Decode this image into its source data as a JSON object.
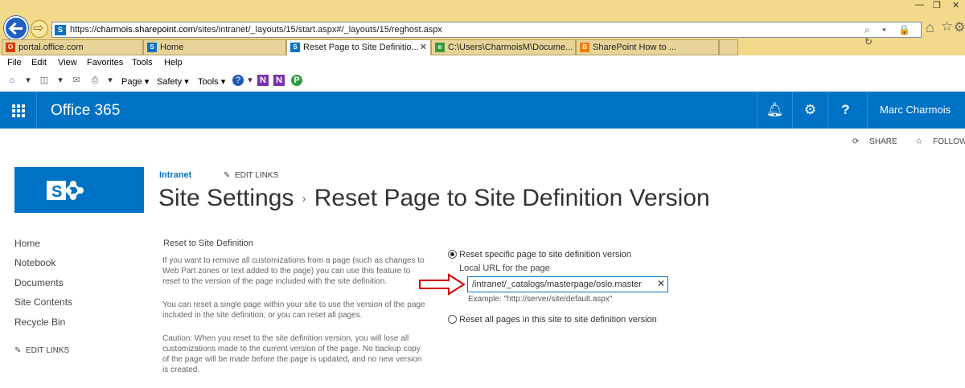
{
  "browser": {
    "address_url_prefix": "https://",
    "address_url_host": "charmois.sharepoint.com",
    "address_url_path": "/sites/intranet/_layouts/15/start.aspx#/_layouts/15/reghost.aspx",
    "address_tools": "⌕ ▾ 🔒 ↻",
    "tabs": [
      {
        "label": "portal.office.com",
        "active": false,
        "color": "#d83b01"
      },
      {
        "label": "Home",
        "active": false,
        "color": "#0b73c5"
      },
      {
        "label": "Reset Page to Site Definitio...",
        "active": true,
        "color": "#0b73c5"
      },
      {
        "label": "C:\\Users\\CharmoisM\\Docume...",
        "active": false,
        "color": "#3c9a3c"
      },
      {
        "label": "SharePoint How to ...",
        "active": false,
        "color": "#f57d00"
      }
    ],
    "tab_close": "✕",
    "menu": [
      "File",
      "Edit",
      "View",
      "Favorites",
      "Tools",
      "Help"
    ],
    "commands": {
      "page": "Page ▾",
      "safety": "Safety ▾",
      "tools": "Tools ▾"
    }
  },
  "suite": {
    "brand": "Office 365",
    "user_name": "Marc Charmois",
    "accent": "#0072c6"
  },
  "actions": {
    "share": "SHARE",
    "follow": "FOLLOW"
  },
  "site": {
    "name": "Intranet",
    "edit_links": "EDIT LINKS",
    "title_part1": "Site Settings",
    "title_sep": "›",
    "title_part2": "Reset Page to Site Definition Version"
  },
  "quick_launch": {
    "items": [
      "Home",
      "Notebook",
      "Documents",
      "Site Contents",
      "Recycle Bin"
    ],
    "edit_links": "EDIT LINKS"
  },
  "form": {
    "section_title": "Reset to Site Definition",
    "desc1": "If you want to remove all customizations from a page (such as changes to Web Part zones or text added to the page) you can use this feature to reset to the version of the page included with the site definition.",
    "desc2": "You can reset a single page within your site to use the version of the page included in the site definition, or you can reset all pages.",
    "desc3": "Caution: When you reset to the site definition version, you will lose all customizations made to the current version of the page. No backup copy of the page will be made before the page is updated, and no new version is created.",
    "option1": "Reset specific page to site definition version",
    "url_label": "Local URL for the page",
    "url_value": "/intranet/_catalogs/masterpage/oslo.master",
    "example": "Example: \"http://server/site/default.aspx\"",
    "option2": "Reset all pages in this site to site definition version",
    "selected_option": 1
  }
}
